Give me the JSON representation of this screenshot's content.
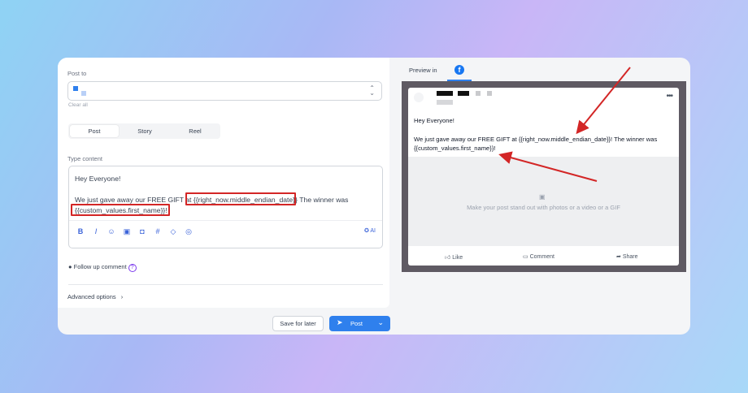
{
  "form": {
    "post_to_label": "Post to",
    "clear_all": "Clear all",
    "tabs": [
      "Post",
      "Story",
      "Reel"
    ],
    "active_tab": "Post",
    "type_content_label": "Type content",
    "content_greeting": "Hey Everyone!",
    "content_line1_prefix": "We just gave away our FREE GIFT at",
    "content_var1": "{{right_now.middle_endian_date}}",
    "content_line1_suffix": "The winner was",
    "content_var2": "{{custom_values.first_name}}",
    "content_var2_suffix": "!",
    "ai_label": "AI",
    "follow_up_label": "Follow up comment",
    "help_symbol": "?",
    "advanced_label": "Advanced options",
    "save_label": "Save for later",
    "post_label": "Post",
    "accent": "#2f80ed",
    "highlight": "#d32626"
  },
  "preview": {
    "label": "Preview in",
    "tab_icon": "facebook-icon",
    "greeting": "Hey Everyone!",
    "line1": "We just gave away our FREE GIFT at {{right_now.middle_endian_date}}! The winner was",
    "line2": "{{custom_values.first_name}}!",
    "media_hint": "Make your post stand out with photos or a video or a GIF",
    "like_label": "Like",
    "comment_label": "Comment",
    "share_label": "Share"
  }
}
